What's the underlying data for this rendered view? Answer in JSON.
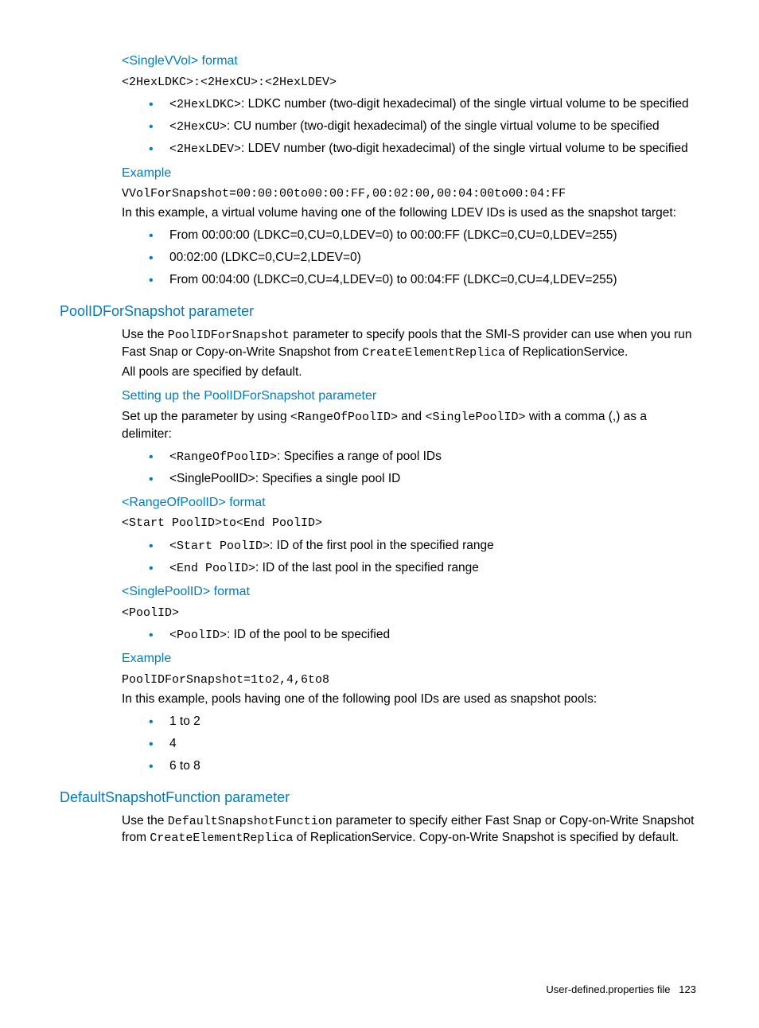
{
  "s1": {
    "h": "<SingleVVol> format",
    "code": "<2HexLDKC>:<2HexCU>:<2HexLDEV>",
    "b1_code": "<2HexLDKC>",
    "b1_t": ": LDKC number (two-digit hexadecimal) of the single virtual volume to be specified",
    "b2_code": "<2HexCU>",
    "b2_t": ": CU number (two-digit hexadecimal) of the single virtual volume to be specified",
    "b3_code": "<2HexLDEV>",
    "b3_t": ": LDEV number (two-digit hexadecimal) of the single virtual volume to be specified"
  },
  "s2": {
    "h": "Example",
    "code": "VVolForSnapshot=00:00:00to00:00:FF,00:02:00,00:04:00to00:04:FF",
    "p": "In this example, a virtual volume having one of the following LDEV IDs is used as the snapshot target:",
    "b1": "From 00:00:00 (LDKC=0,CU=0,LDEV=0) to 00:00:FF (LDKC=0,CU=0,LDEV=255)",
    "b2": "00:02:00 (LDKC=0,CU=2,LDEV=0)",
    "b3": "From 00:04:00 (LDKC=0,CU=4,LDEV=0) to 00:04:FF (LDKC=0,CU=4,LDEV=255)"
  },
  "s3": {
    "h": "PoolIDForSnapshot parameter",
    "p1a": "Use the ",
    "p1code1": "PoolIDForSnapshot",
    "p1b": " parameter to specify pools that the SMI-S provider can use when you run Fast Snap or Copy-on-Write Snapshot from ",
    "p1code2": "CreateElementReplica",
    "p1c": " of ReplicationService.",
    "p2": "All pools are specified by default."
  },
  "s4": {
    "h": "Setting up the PoolIDForSnapshot parameter",
    "p_a": "Set up the parameter by using ",
    "p_code1": "<RangeOfPoolID>",
    "p_b": " and ",
    "p_code2": "<SinglePoolID>",
    "p_c": " with a comma (,) as a delimiter:",
    "b1_code": "<RangeOfPoolID>",
    "b1_t": ": Specifies a range of pool IDs",
    "b2": "<SinglePoolID>: Specifies a single pool ID"
  },
  "s5": {
    "h": "<RangeOfPoolID> format",
    "code": "<Start PoolID>to<End PoolID>",
    "b1_code": "<Start PoolID>",
    "b1_t": ": ID of the first pool in the specified range",
    "b2_code": "<End PoolID>",
    "b2_t": ": ID of the last pool in the specified range"
  },
  "s6": {
    "h": "<SinglePoolID> format",
    "code": "<PoolID>",
    "b1_code": "<PoolID>",
    "b1_t": ": ID of the pool to be specified"
  },
  "s7": {
    "h": "Example",
    "code": "PoolIDForSnapshot=1to2,4,6to8",
    "p": "In this example, pools having one of the following pool IDs are used as snapshot pools:",
    "b1": "1 to 2",
    "b2": "4",
    "b3": "6 to 8"
  },
  "s8": {
    "h": "DefaultSnapshotFunction parameter",
    "p_a": "Use the ",
    "p_code1": "DefaultSnapshotFunction",
    "p_b": " parameter to specify either Fast Snap or Copy-on-Write Snapshot from ",
    "p_code2": "CreateElementReplica",
    "p_c": " of ReplicationService. Copy-on-Write Snapshot is specified by default."
  },
  "footer": {
    "label": "User-defined.properties file",
    "page": "123"
  }
}
